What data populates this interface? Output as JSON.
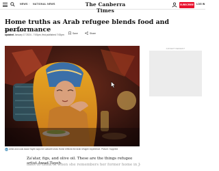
{
  "header": {
    "nav": [
      "NEWS",
      "NATIONAL NEWS"
    ],
    "brand": "The Canberra Times",
    "subscribe_label": "SUBSCRIBE",
    "login_label": "LOG IN"
  },
  "article": {
    "headline": "Home truths as Arab refugee blends food and performance",
    "byline": "By Debra Ferguson",
    "updated_label": "Updated",
    "updated_text": "January 17 2024 - 7:00pm, first published 7:00pm",
    "actions": {
      "save": "Save",
      "share": "Share"
    },
    "caption": "Artist and cook Awad Tayeh says her cabaret show Home reflects the Arab refugee experience. Picture: Supplied",
    "lead": "Za'atar, figs, and olive oil. These are the things refugee artist Awad Tayeh",
    "lead_faded": "likes to think of when she remembers her former home in Jerusalem."
  },
  "ad": {
    "label": "ADVERTISEMENT"
  },
  "colors": {
    "brand_red": "#e8112d"
  }
}
